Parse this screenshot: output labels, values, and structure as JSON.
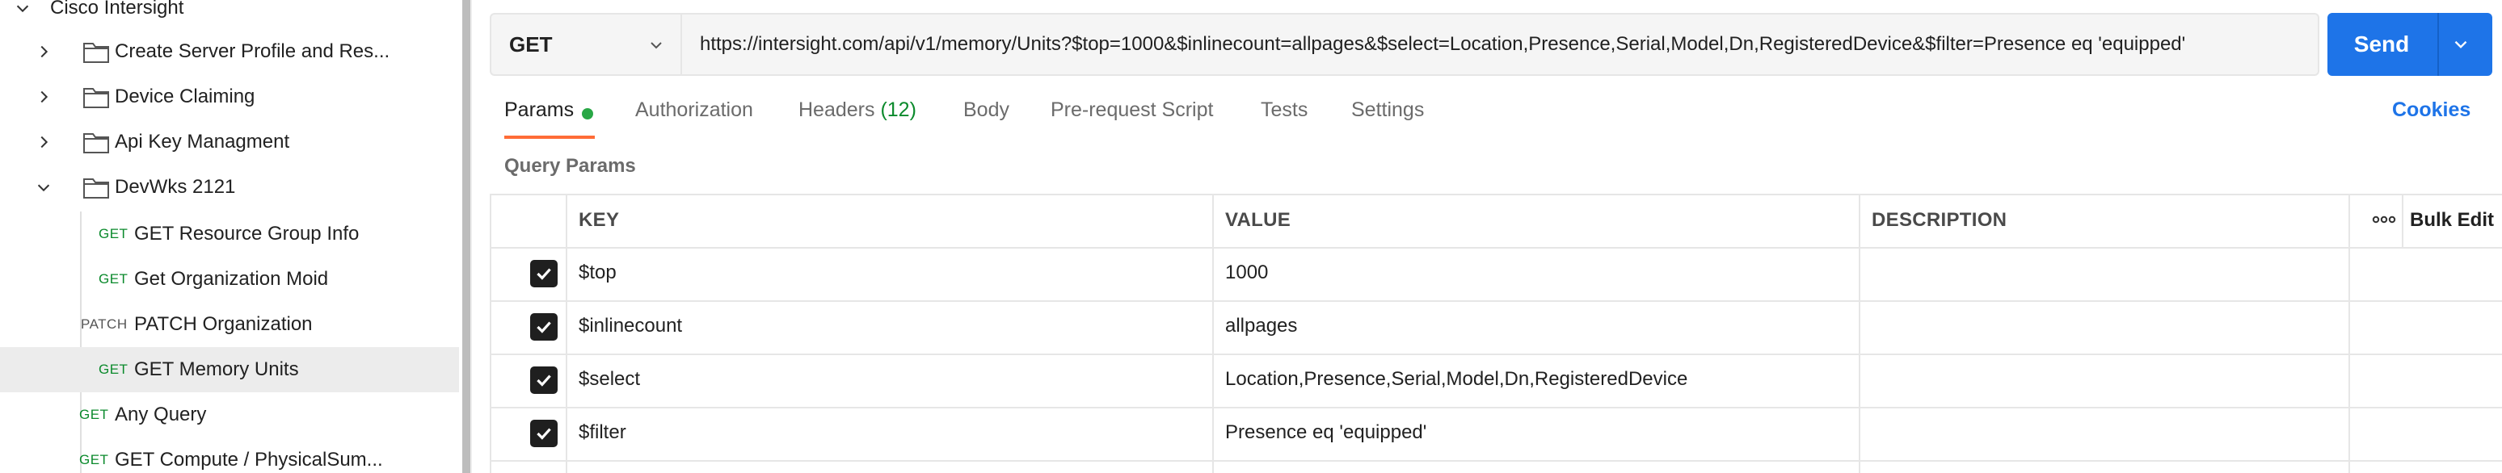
{
  "sidebar": {
    "items": [
      {
        "label": "Cisco Intersight",
        "kind": "collection",
        "chevron": "down"
      },
      {
        "label": "Create Server Profile and Res...",
        "kind": "folder",
        "chevron": "right"
      },
      {
        "label": "Device Claiming",
        "kind": "folder",
        "chevron": "right"
      },
      {
        "label": "Api Key Managment",
        "kind": "folder",
        "chevron": "right"
      },
      {
        "label": "DevWks 2121",
        "kind": "folder",
        "chevron": "down"
      },
      {
        "label": "GET Resource Group Info",
        "kind": "request",
        "method": "GET"
      },
      {
        "label": "Get Organization Moid",
        "kind": "request",
        "method": "GET"
      },
      {
        "label": "PATCH Organization",
        "kind": "request",
        "method": "PATCH"
      },
      {
        "label": "GET Memory Units",
        "kind": "request",
        "method": "GET",
        "selected": true
      },
      {
        "label": "Any Query",
        "kind": "request",
        "method": "GET"
      },
      {
        "label": "GET Compute / PhysicalSum...",
        "kind": "request",
        "method": "GET"
      }
    ]
  },
  "request": {
    "method": "GET",
    "url": "https://intersight.com/api/v1/memory/Units?$top=1000&$inlinecount=allpages&$select=Location,Presence,Serial,Model,Dn,RegisteredDevice&$filter=Presence eq 'equipped'",
    "send_label": "Send"
  },
  "tabs": [
    {
      "label": "Params",
      "active": true
    },
    {
      "label": "Authorization"
    },
    {
      "label": "Headers",
      "count": "(12)"
    },
    {
      "label": "Body"
    },
    {
      "label": "Pre-request Script"
    },
    {
      "label": "Tests"
    },
    {
      "label": "Settings"
    }
  ],
  "cookies_label": "Cookies",
  "query_params": {
    "title": "Query Params",
    "headers": {
      "key": "KEY",
      "value": "VALUE",
      "description": "DESCRIPTION",
      "bulk_edit": "Bulk Edit"
    },
    "rows": [
      {
        "checked": true,
        "key": "$top",
        "value": "1000",
        "description": ""
      },
      {
        "checked": true,
        "key": "$inlinecount",
        "value": "allpages",
        "description": ""
      },
      {
        "checked": true,
        "key": "$select",
        "value": "Location,Presence,Serial,Model,Dn,RegisteredDevice",
        "description": ""
      },
      {
        "checked": true,
        "key": "$filter",
        "value": "Presence eq 'equipped'",
        "description": ""
      }
    ]
  },
  "colors": {
    "accent": "#1e74e8",
    "active_tab_underline": "#ff6c37",
    "method_get": "#0b8a2c",
    "params_dot": "#28a745"
  }
}
